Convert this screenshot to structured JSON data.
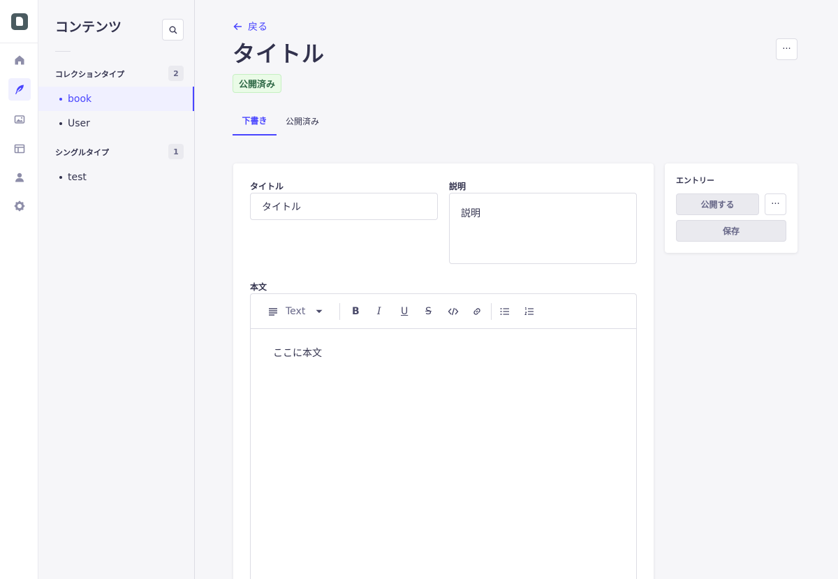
{
  "rail": {
    "items": [
      {
        "name": "home-icon",
        "active": false
      },
      {
        "name": "feather-icon",
        "active": true
      },
      {
        "name": "media-icon",
        "active": false
      },
      {
        "name": "layout-icon",
        "active": false
      },
      {
        "name": "user-icon",
        "active": false
      },
      {
        "name": "gear-icon",
        "active": false
      }
    ]
  },
  "sidebar": {
    "title": "コンテンツ",
    "collection_label": "コレクションタイプ",
    "collection_count": "2",
    "collection_items": [
      "book",
      "User"
    ],
    "single_label": "シングルタイプ",
    "single_count": "1",
    "single_items": [
      "test"
    ]
  },
  "header": {
    "back_label": "戻る",
    "title": "タイトル",
    "more_label": "···",
    "status_badge": "公開済み"
  },
  "tabs": [
    {
      "label": "下書き",
      "active": true
    },
    {
      "label": "公開済み",
      "active": false
    }
  ],
  "form": {
    "title_label": "タイトル",
    "title_value": "タイトル",
    "description_label": "説明",
    "description_value": "説明",
    "body_label": "本文",
    "body_value": "ここに本文",
    "toolbar": {
      "block_type": "Text",
      "bold": "B",
      "italic": "I",
      "underline": "U",
      "strike": "S"
    }
  },
  "entry_panel": {
    "title": "エントリー",
    "publish_label": "公開する",
    "more_label": "···",
    "save_label": "保存"
  },
  "colors": {
    "primary": "#4945ff",
    "success_bg": "#eafbe7",
    "success_text": "#2f6846"
  }
}
